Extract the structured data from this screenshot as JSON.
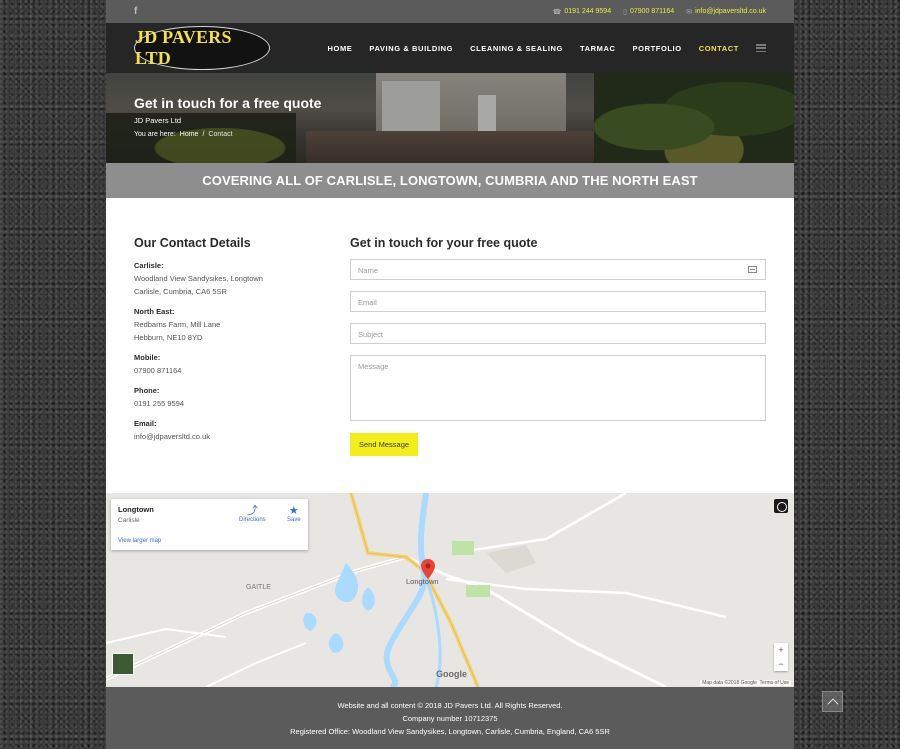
{
  "topbar": {
    "social_icon": "facebook-icon",
    "social_glyph": "f",
    "phone1": "0191 244 9594",
    "phone2": "07900 871164",
    "email": "info@jdpaversltd.co.uk"
  },
  "header": {
    "logo_text": "JD PAVERS LTD",
    "nav": [
      "HOME",
      "PAVING & BUILDING",
      "CLEANING & SEALING",
      "TARMAC",
      "PORTFOLIO",
      "CONTACT"
    ],
    "active_nav": "CONTACT"
  },
  "banner": {
    "title": "Get in touch for a free quote",
    "subtitle": "JD Pavers Ltd",
    "breadcrumb_prefix": "You are here:",
    "breadcrumb_home": "Home",
    "breadcrumb_sep": "/",
    "breadcrumb_current": "Contact"
  },
  "covering": "COVERING ALL OF CARLISLE, LONGTOWN, CUMBRIA AND THE NORTH EAST",
  "contact": {
    "heading": "Our Contact Details",
    "carlisle_label": "Carlisle:",
    "carlisle_line1": "Woodland View Sandysikes, Longtown",
    "carlisle_line2": "Carlisle, Cumbria, CA6 5SR",
    "northeast_label": "North East:",
    "northeast_line1": "Redbarns Farm, Mill Lane",
    "northeast_line2": "Hebburn, NE10 8YD",
    "mobile_label": "Mobile:",
    "mobile": "07900 871164",
    "phone_label": "Phone:",
    "phone": "0191 255 9594",
    "email_label": "Email:",
    "email": "info@jdpaversltd.co.uk"
  },
  "form": {
    "heading": "Get in touch for your free quote",
    "name_placeholder": "Name",
    "email_placeholder": "Email",
    "subject_placeholder": "Subject",
    "message_placeholder": "Message",
    "send_label": "Send Message"
  },
  "map": {
    "place": "Longtown",
    "region": "Carlisle",
    "directions": "Directions",
    "save": "Save",
    "larger_map": "View larger map",
    "town_label": "Longtown",
    "gaitle_label": "GAITLE",
    "google": "Google",
    "map_data": "Map data ©2018 Google",
    "terms": "Terms of Use",
    "zoom_in": "+",
    "zoom_out": "−"
  },
  "footer": {
    "line1": "Website and all content © 2018 JD Pavers Ltd. All Rights Reserved.",
    "line2": "Company number 10712375",
    "line3": "Registered Office: Woodland View Sandysikes, Longtown, Carlisle, Cumbria, England, CA6 5SR"
  }
}
